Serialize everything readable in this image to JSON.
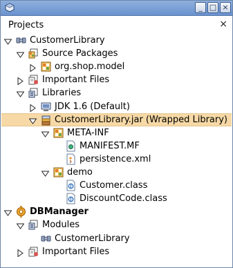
{
  "panel": {
    "title": "Projects",
    "close_glyph": "×"
  },
  "window_buttons": {
    "minimize": "_",
    "maximize": "□",
    "close": "×"
  },
  "tree": [
    {
      "label": "CustomerLibrary",
      "icon": "project-icon",
      "toggle": "expanded",
      "level": 0
    },
    {
      "label": "Source Packages",
      "icon": "source-packages-icon",
      "toggle": "expanded",
      "level": 1
    },
    {
      "label": "org.shop.model",
      "icon": "package-icon",
      "toggle": "collapsed",
      "level": 2
    },
    {
      "label": "Important Files",
      "icon": "important-files-icon",
      "toggle": "collapsed",
      "level": 1
    },
    {
      "label": "Libraries",
      "icon": "libraries-icon",
      "toggle": "expanded",
      "level": 1
    },
    {
      "label": "JDK 1.6 (Default)",
      "icon": "jdk-icon",
      "toggle": "collapsed",
      "level": 2
    },
    {
      "label": "CustomerLibrary.jar (Wrapped Library)",
      "icon": "jar-icon",
      "toggle": "expanded",
      "level": 2,
      "selected": true
    },
    {
      "label": "META-INF",
      "icon": "package-icon",
      "toggle": "expanded",
      "level": 3
    },
    {
      "label": "MANIFEST.MF",
      "icon": "manifest-file-icon",
      "toggle": "none",
      "level": 4
    },
    {
      "label": "persistence.xml",
      "icon": "xml-file-icon",
      "toggle": "none",
      "level": 4
    },
    {
      "label": "demo",
      "icon": "package-icon",
      "toggle": "expanded",
      "level": 3
    },
    {
      "label": "Customer.class",
      "icon": "class-file-icon",
      "toggle": "none",
      "level": 4
    },
    {
      "label": "DiscountCode.class",
      "icon": "class-file-icon",
      "toggle": "none",
      "level": 4
    },
    {
      "label": "DBManager",
      "icon": "app-project-icon",
      "toggle": "expanded",
      "level": 0,
      "bold": true
    },
    {
      "label": "Modules",
      "icon": "modules-icon",
      "toggle": "expanded",
      "level": 1
    },
    {
      "label": "CustomerLibrary",
      "icon": "project-icon",
      "toggle": "none",
      "level": 2
    },
    {
      "label": "Important Files",
      "icon": "important-files-icon",
      "toggle": "collapsed",
      "level": 1
    }
  ]
}
